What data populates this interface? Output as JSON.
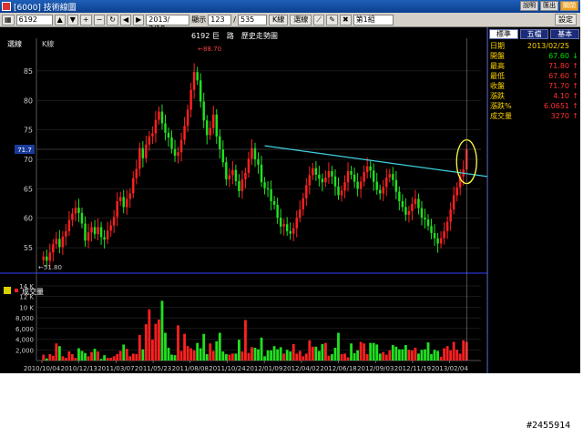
{
  "window": {
    "title": "[6000] 技術線圖",
    "buttons": [
      "說明",
      "匯出",
      "關閉"
    ]
  },
  "toolbar": {
    "code": "6192",
    "date": "2013/ 3/18",
    "display_label": "顯示",
    "display_from": "123",
    "display_to": "535",
    "k_type": "K線",
    "indicator": "選線",
    "group": "第1組",
    "set_button": "設定"
  },
  "chart_header": {
    "left_label": "選線",
    "k_label": "K線",
    "center_title": "6192 巨　路　歷史走勢圖",
    "high_marker": "88.70",
    "low_marker": "51.80",
    "cursor_level": "71.7",
    "volume_label": "成交量"
  },
  "panel": {
    "tabs": [
      "標準",
      "五檔",
      "基本"
    ],
    "rows": [
      {
        "label": "日期",
        "value": "2013/02/25",
        "arrow": "",
        "color": "#ffd400"
      },
      {
        "label": "開盤",
        "value": "67.60",
        "arrow": "↓",
        "color": "#00e000"
      },
      {
        "label": "最高",
        "value": "71.80",
        "arrow": "↑",
        "color": "#ff3030"
      },
      {
        "label": "最低",
        "value": "67.60",
        "arrow": "↑",
        "color": "#ff3030"
      },
      {
        "label": "收盤",
        "value": "71.70",
        "arrow": "↑",
        "color": "#ff3030"
      },
      {
        "label": "漲跌",
        "value": "4.10",
        "arrow": "↑",
        "color": "#ff3030"
      },
      {
        "label": "漲跌%",
        "value": "6.0651",
        "arrow": "↑",
        "color": "#ff3030"
      },
      {
        "label": "成交量",
        "value": "3270",
        "arrow": "↑",
        "color": "#ff3030"
      }
    ]
  },
  "watermark": "#2455914",
  "colors": {
    "up": "#ff2020",
    "down": "#20e020",
    "trendline": "#40d0e0",
    "highlight": "#ffff40",
    "grid": "#333333",
    "axis": "#3040ff"
  },
  "chart_data": [
    {
      "type": "candlestick",
      "title": "6192 巨　路　歷史走勢圖",
      "x_ticks": [
        "2010/10/04",
        "2010/12/13",
        "2011/03/07",
        "2011/05/23",
        "2011/08/08",
        "2011/10/24",
        "2012/01/09",
        "2012/04/02",
        "2012/06/18",
        "2012/09/03",
        "2012/11/19",
        "2013/02/04"
      ],
      "y_ticks": [
        55,
        60,
        65,
        70,
        75,
        80,
        85
      ],
      "ylim": [
        51,
        89
      ],
      "closes": [
        53.5,
        52.8,
        54.2,
        55.6,
        56.5,
        55.1,
        56.9,
        57.8,
        59.7,
        60.8,
        61.8,
        60.9,
        59.1,
        56.2,
        57.6,
        58.5,
        57.3,
        58.5,
        56.8,
        56.4,
        57.9,
        58.8,
        60.2,
        62.9,
        63.6,
        61.9,
        63.3,
        64.2,
        66.8,
        68.4,
        71.9,
        70.2,
        72.5,
        73.9,
        74.4,
        76.7,
        78.1,
        76.1,
        74.5,
        73.7,
        71.8,
        70.6,
        71.2,
        73.3,
        75.7,
        78.4,
        81.8,
        84.8,
        83.4,
        79.8,
        76.6,
        74.1,
        75.3,
        77.6,
        73.9,
        71.7,
        69.5,
        66.6,
        67.3,
        68.2,
        66.3,
        64.6,
        66.6,
        67.7,
        70.1,
        71.9,
        70.0,
        69.1,
        66.1,
        65.1,
        64.9,
        62.9,
        62.3,
        60.1,
        58.6,
        59.0,
        57.8,
        57.4,
        58.3,
        60.1,
        61.5,
        63.4,
        65.6,
        67.3,
        68.5,
        67.4,
        66.7,
        66.1,
        66.9,
        68.0,
        67.1,
        65.4,
        63.9,
        64.7,
        66.1,
        68.0,
        67.4,
        66.2,
        65.0,
        66.2,
        67.8,
        68.8,
        68.1,
        66.2,
        64.8,
        64.2,
        65.3,
        66.9,
        67.5,
        66.5,
        64.5,
        62.9,
        61.9,
        60.6,
        61.2,
        62.4,
        63.3,
        61.7,
        60.1,
        59.8,
        58.7,
        57.5,
        56.6,
        55.7,
        56.6,
        57.8,
        59.4,
        61.5,
        63.9,
        65.2,
        67.1,
        68.3,
        71.7
      ],
      "volume_ticks": [
        "2,000",
        "4,000",
        "6,000",
        "8,000",
        "10 K",
        "12 K",
        "14 K"
      ],
      "volume_max": 14000,
      "volumes": [
        1100,
        400,
        1200,
        900,
        3200,
        2700,
        800,
        500,
        1700,
        1200,
        500,
        2300,
        1800,
        1400,
        800,
        1600,
        2200,
        1700,
        300,
        1000,
        500,
        500,
        800,
        1200,
        1800,
        3000,
        2200,
        800,
        1300,
        1200,
        4800,
        2100,
        6800,
        9600,
        3900,
        6900,
        7700,
        11200,
        5200,
        2400,
        1100,
        1000,
        6600,
        1800,
        5000,
        2700,
        2300,
        1900,
        3300,
        2300,
        5000,
        1200,
        3200,
        1800,
        3600,
        5200,
        1700,
        1200,
        1100,
        1300,
        1300,
        3900,
        1700,
        7600,
        1400,
        2500,
        2400,
        2100,
        4300,
        800,
        1900,
        1900,
        2700,
        2100,
        2500,
        1300,
        2000,
        1700,
        3100,
        1300,
        1800,
        800,
        1300,
        3800,
        2600,
        2600,
        1800,
        3100,
        3300,
        900,
        1200,
        2400,
        5200,
        1200,
        1300,
        600,
        3200,
        1400,
        1900,
        3500,
        3200,
        1200,
        3300,
        3300,
        3000,
        1300,
        1600,
        1100,
        1900,
        2900,
        2600,
        2100,
        2100,
        2900,
        2000,
        1900,
        2400,
        1300,
        2000,
        2100,
        3400,
        1200,
        2000,
        1800,
        700,
        2300,
        2700,
        1900,
        3500,
        2000,
        1300,
        3800,
        3500,
        3600
      ]
    }
  ]
}
